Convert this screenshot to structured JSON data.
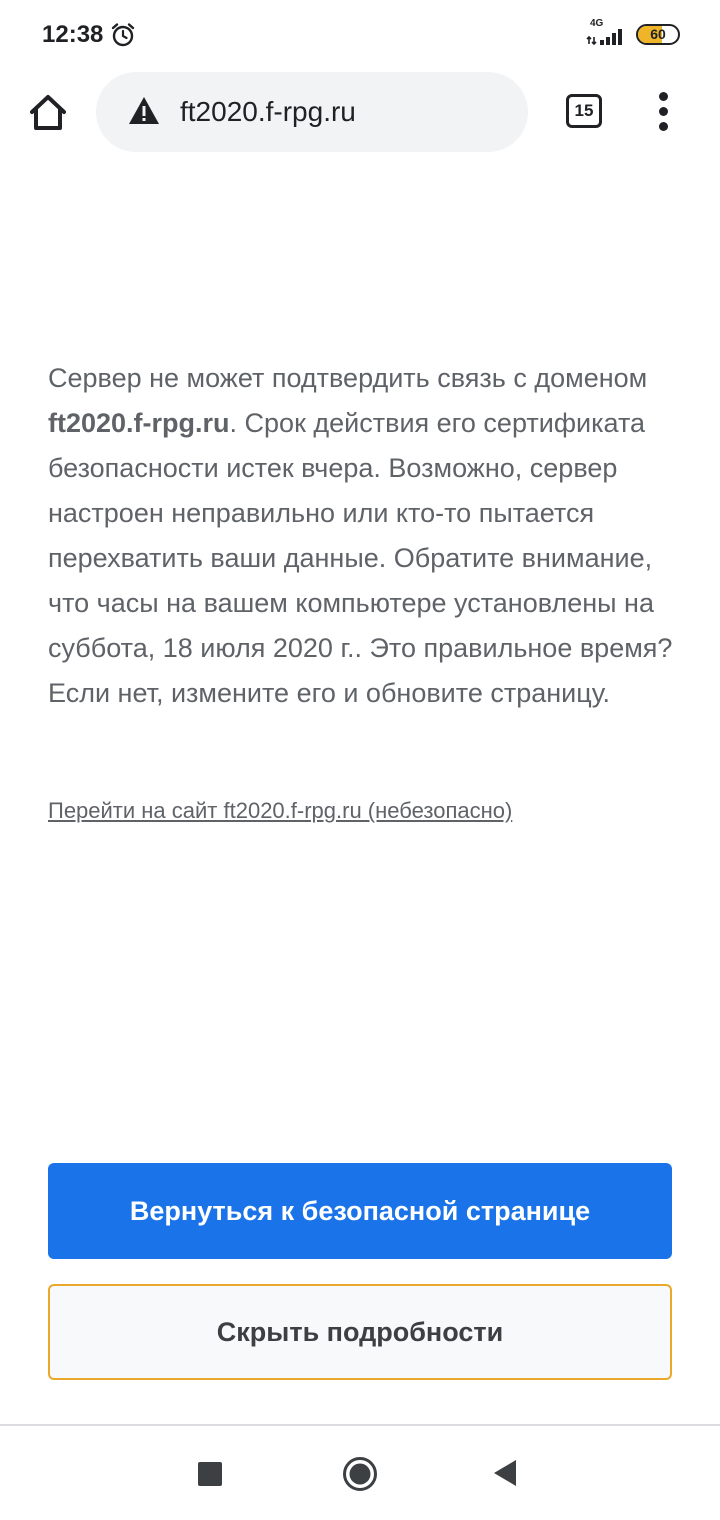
{
  "status_bar": {
    "time": "12:38",
    "network_type": "4G",
    "battery_percent": "60",
    "battery_level": 0.6,
    "alarm_icon": "alarm-clock-icon",
    "signal_icon": "cellular-signal-icon"
  },
  "toolbar": {
    "home_icon": "home-icon",
    "security_icon": "warning-triangle-icon",
    "url": "ft2020.f-rpg.ru",
    "tab_count": "15",
    "menu_icon": "more-vert-icon"
  },
  "content": {
    "text_before_domain": "Сервер не может подтвердить связь с доменом ",
    "domain": "ft2020.f-rpg.ru",
    "text_after_domain": ". Срок действия его сертификата безопасности истек вчера. Возможно, сервер настроен неправильно или кто-то пытается перехватить ваши данные. Обратите внимание, что часы на вашем компьютере установлены на суббота, 18 июля 2020 г.. Это правильное время? Если нет, измените его и обновите страницу.",
    "proceed_link": "Перейти на сайт ft2020.f-rpg.ru (небезопасно)"
  },
  "buttons": {
    "back_to_safety": "Вернуться к безопасной странице",
    "hide_details": "Скрыть подробности"
  },
  "nav_bar": {
    "recents_icon": "square-recents-icon",
    "home_icon": "circle-home-icon",
    "back_icon": "triangle-back-icon"
  },
  "colors": {
    "primary_button": "#1a73e8",
    "secondary_button_border": "#e8a92c",
    "body_text": "#5f6368",
    "battery_fill": "#f0b429"
  }
}
